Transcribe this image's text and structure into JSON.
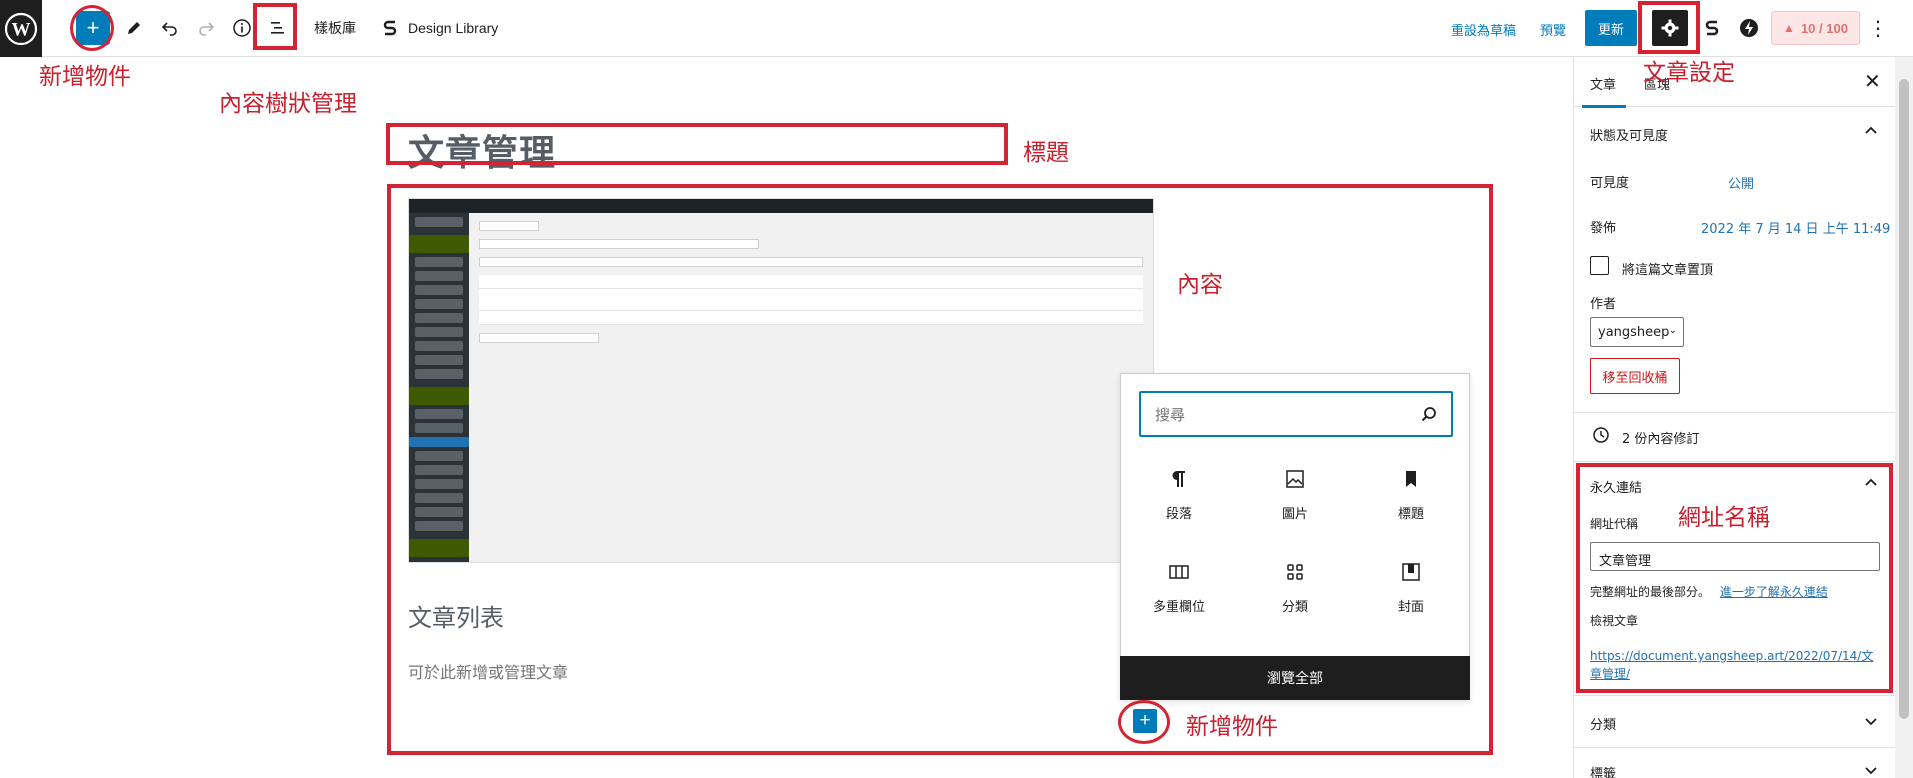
{
  "toolbar": {
    "templates_label": "樣板庫",
    "design_library_label": "Design Library",
    "save_draft_label": "重設為草稿",
    "preview_label": "預覽",
    "update_label": "更新",
    "score_label": "10 / 100"
  },
  "annotations": {
    "add_block": "新增物件",
    "list_view": "內容樹狀管理",
    "title": "標題",
    "content": "內容",
    "post_settings": "文章設定",
    "slug": "網址名稱",
    "add_block_bottom": "新增物件"
  },
  "editor": {
    "post_title": "文章管理",
    "heading": "文章列表",
    "paragraph": "可於此新增或管理文章"
  },
  "inserter": {
    "search_placeholder": "搜尋",
    "blocks": [
      {
        "label": "段落",
        "icon": "paragraph-icon"
      },
      {
        "label": "圖片",
        "icon": "image-icon"
      },
      {
        "label": "標題",
        "icon": "heading-bookmark-icon"
      },
      {
        "label": "多重欄位",
        "icon": "columns-icon"
      },
      {
        "label": "分類",
        "icon": "categories-icon"
      },
      {
        "label": "封面",
        "icon": "cover-icon"
      }
    ],
    "browse_all": "瀏覽全部"
  },
  "settings": {
    "tab_post": "文章",
    "tab_block": "區塊",
    "status_title": "狀態及可見度",
    "visibility_label": "可見度",
    "visibility_value": "公開",
    "publish_label": "發佈",
    "publish_value": "2022 年 7 月 14 日 上午 11:49",
    "sticky_label": "將這篇文章置頂",
    "author_label": "作者",
    "author_value": "yangsheep",
    "trash_label": "移至回收桶",
    "revisions_label": "2 份內容修訂",
    "permalink_title": "永久連結",
    "slug_label": "網址代稱",
    "slug_value": "文章管理",
    "slug_help": "完整網址的最後部分。",
    "learn_more": "進一步了解永久連結",
    "view_post_label": "檢視文章",
    "view_post_url": "https://document.yangsheep.art/2022/07/14/文章管理/",
    "categories_title": "分類",
    "tags_title": "標籤"
  },
  "colors": {
    "accent": "#007cba",
    "annotation_red": "#d42434",
    "dark": "#1e1e1e"
  }
}
